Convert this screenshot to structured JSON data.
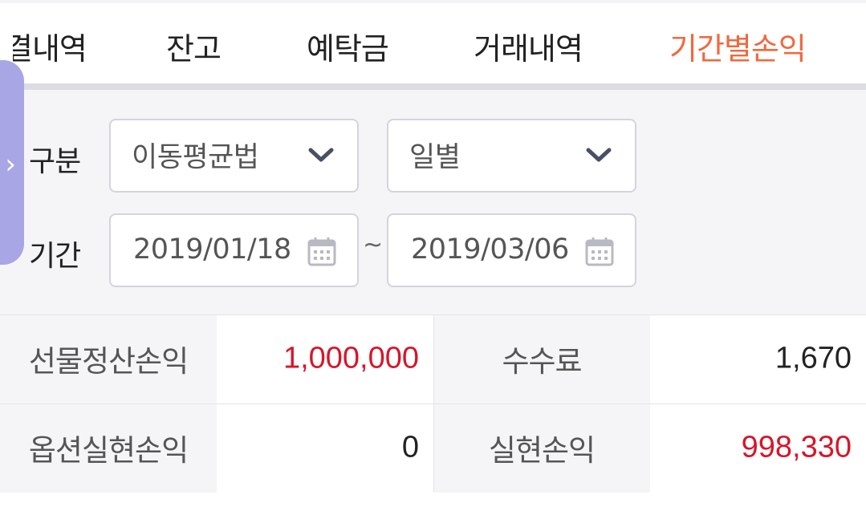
{
  "tabs": [
    {
      "label": "결내역",
      "active": false
    },
    {
      "label": "잔고",
      "active": false
    },
    {
      "label": "예탁금",
      "active": false
    },
    {
      "label": "거래내역",
      "active": false
    },
    {
      "label": "기간별손익",
      "active": true
    }
  ],
  "filter": {
    "category_label": "구분",
    "method_select": "이동평균법",
    "period_type_select": "일별",
    "period_label": "기간",
    "start_date": "2019/01/18",
    "separator": "~",
    "end_date": "2019/03/06"
  },
  "summary": {
    "futures_pnl_label": "선물정산손익",
    "futures_pnl_value": "1,000,000",
    "fee_label": "수수료",
    "fee_value": "1,670",
    "options_pnl_label": "옵션실현손익",
    "options_pnl_value": "0",
    "realized_pnl_label": "실현손익",
    "realized_pnl_value": "998,330"
  },
  "colors": {
    "accent": "#ee6a3f",
    "profit_red": "#d6162a",
    "side_handle": "#a9a6e6"
  },
  "icons": [
    "chevron-right-icon",
    "chevron-down-icon",
    "calendar-icon"
  ]
}
